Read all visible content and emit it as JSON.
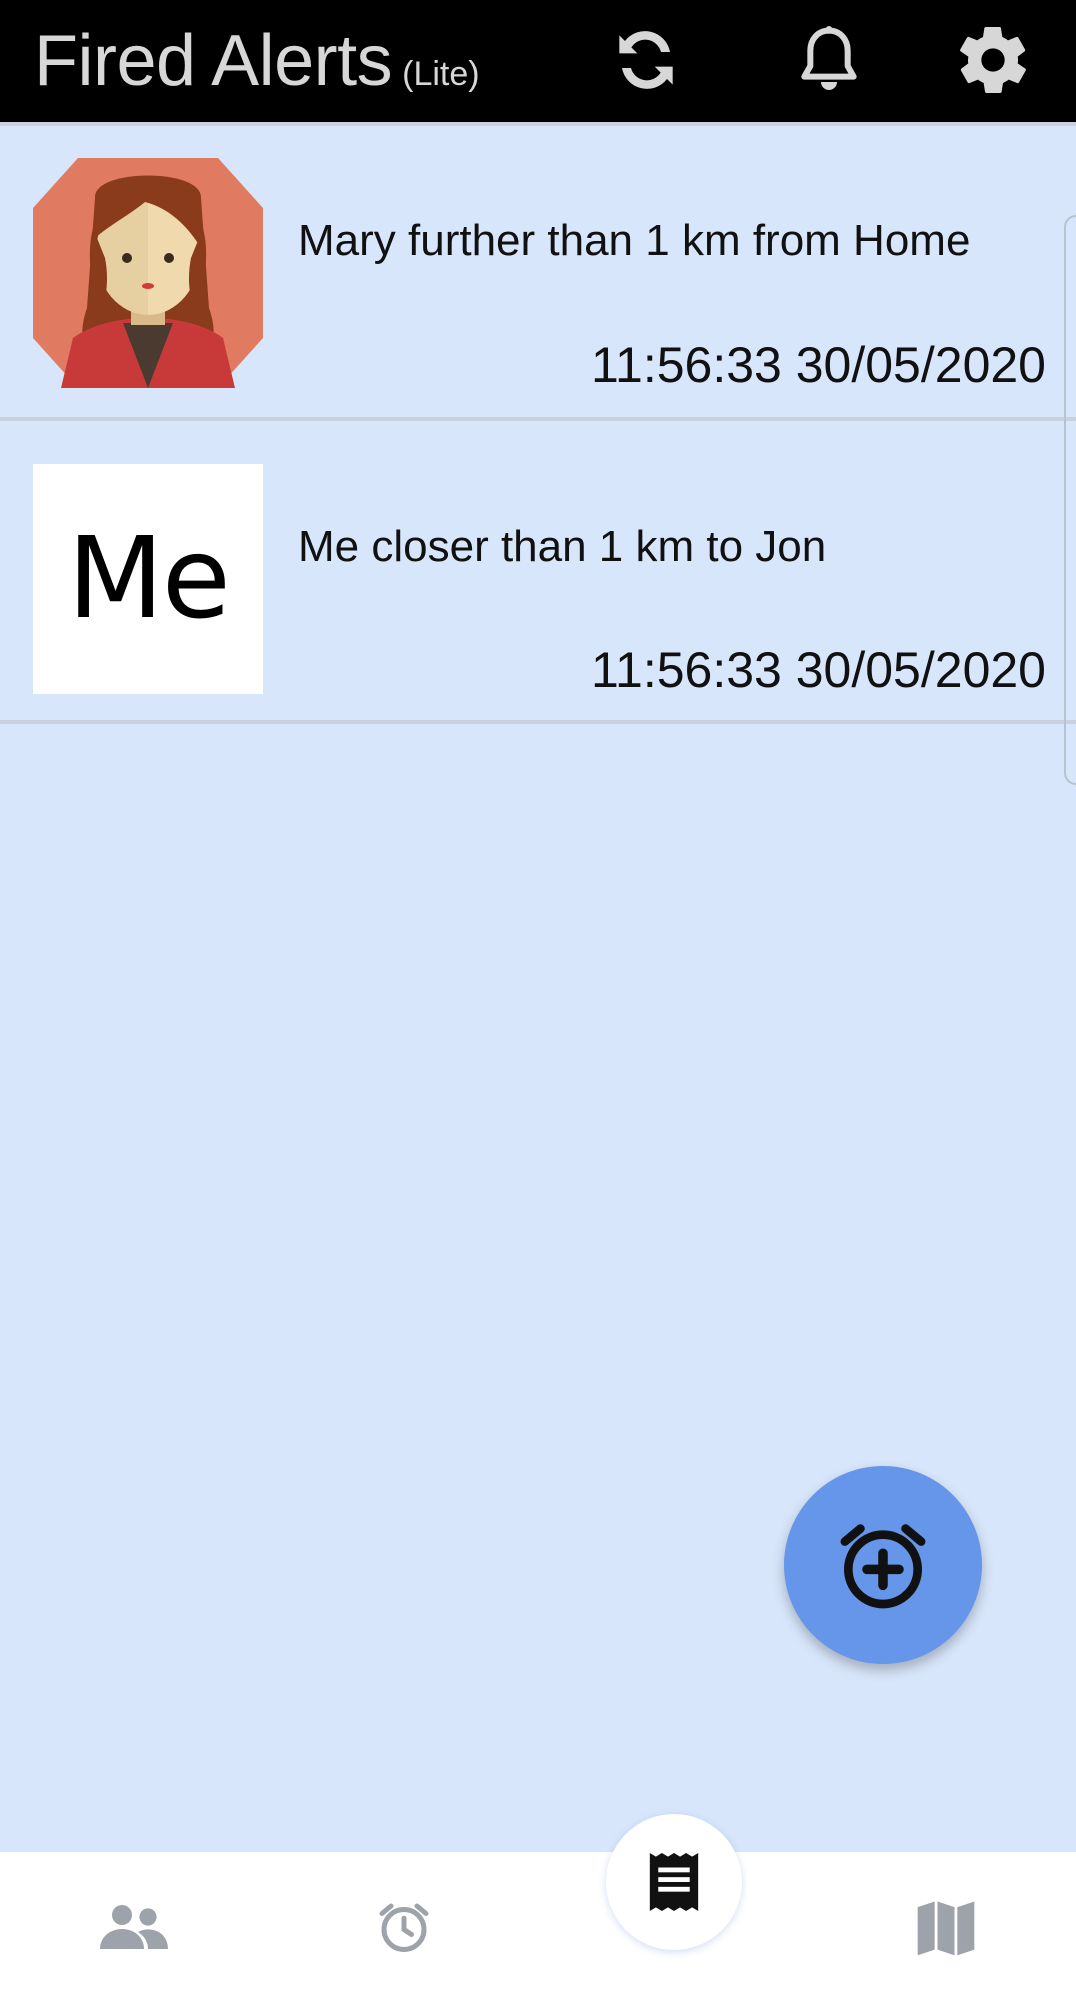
{
  "header": {
    "title": "Fired Alerts",
    "subtitle": "(Lite)",
    "icons": [
      "refresh-icon",
      "bell-icon",
      "gear-icon"
    ]
  },
  "alerts": [
    {
      "avatar": "woman-avatar",
      "message": "Mary further than 1 km from Home",
      "time": "11:56:33 30/05/2020"
    },
    {
      "avatar_text": "Me",
      "message": "Me closer than 1 km to Jon",
      "time": "11:56:33 30/05/2020"
    }
  ],
  "fab": {
    "icon": "alarm-add-icon"
  },
  "bottom_nav": {
    "items": [
      "people-icon",
      "alarm-icon",
      "receipt-icon",
      "map-icon"
    ],
    "active": "receipt-icon"
  },
  "colors": {
    "background": "#d8e6fb",
    "header": "#000000",
    "header_text": "#d7d7d7",
    "fab": "#6596ea",
    "nav_icon_inactive": "#9ea3ab",
    "divider": "#c9d1de"
  }
}
